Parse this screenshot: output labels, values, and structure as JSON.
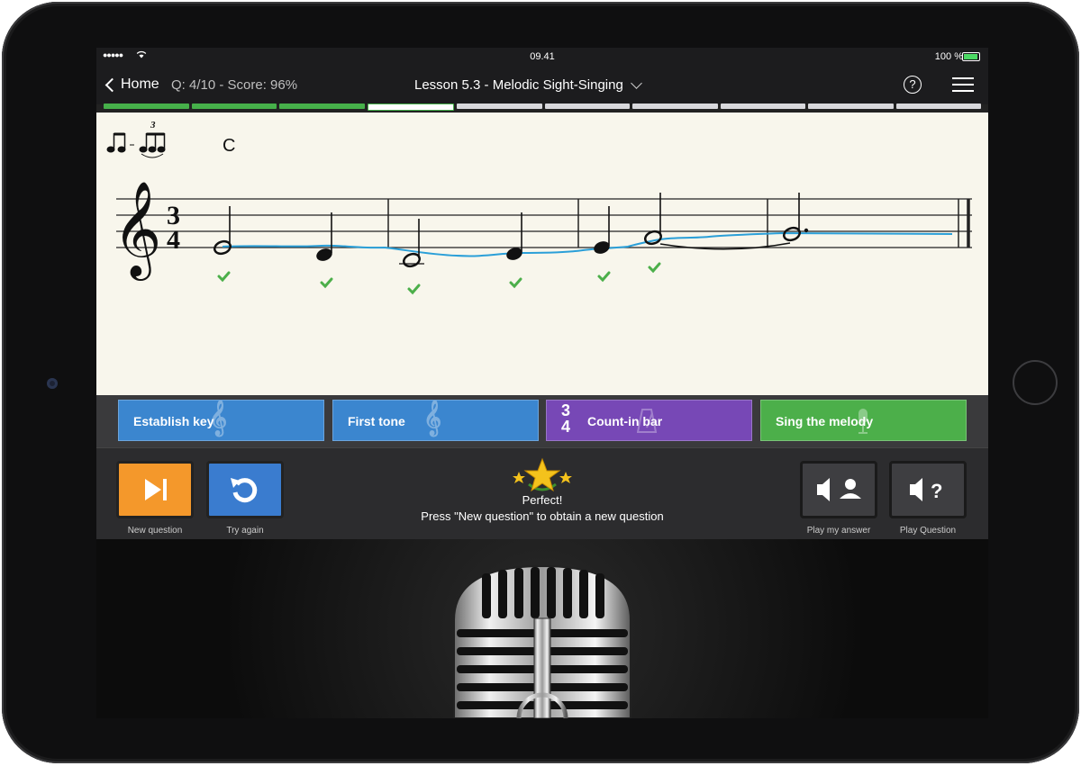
{
  "status": {
    "time": "09.41",
    "battery": "100 %",
    "signal": "●●●●●"
  },
  "nav": {
    "back_label": "Home",
    "qscore": "Q: 4/10 - Score: 96%",
    "title": "Lesson 5.3 - Melodic Sight-Singing"
  },
  "progress": {
    "total": 10,
    "completed": 3,
    "current": 4
  },
  "score": {
    "chord_symbol": "C",
    "time_signature_top": "3",
    "time_signature_bottom": "4",
    "tuplet_number": "3"
  },
  "tasks": {
    "establish_key": "Establish key",
    "first_tone": "First tone",
    "count_in": "Count-in bar",
    "count_in_top": "3",
    "count_in_bottom": "4",
    "sing": "Sing the melody"
  },
  "controls": {
    "new_question": "New question",
    "try_again": "Try again",
    "play_my_answer": "Play my answer",
    "play_question": "Play Question",
    "play_question_glyph": "?"
  },
  "result": {
    "title": "Perfect!",
    "message": "Press \"New question\" to obtain a new question"
  },
  "colors": {
    "green": "#46b04a",
    "blue": "#3b86cf",
    "purple": "#7748b6",
    "orange": "#f4982b",
    "pitch_line": "#2a9fd8"
  }
}
